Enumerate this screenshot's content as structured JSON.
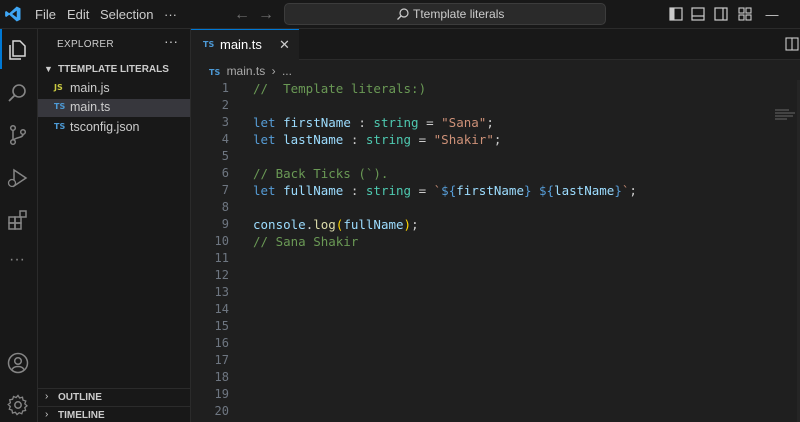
{
  "menu": {
    "file": "File",
    "edit": "Edit",
    "selection": "Selection",
    "more": "···"
  },
  "search": {
    "text": "Ttemplate literals"
  },
  "sidebar": {
    "title": "EXPLORER",
    "more": "···",
    "folder": "TTEMPLATE LITERALS",
    "files": [
      {
        "icon": "JS",
        "name": "main.js",
        "icon_color": "#cbcb41"
      },
      {
        "icon": "TS",
        "name": "main.ts",
        "icon_color": "#4d9ad6"
      },
      {
        "icon": "TS",
        "name": "tsconfig.json",
        "icon_color": "#4d9ad6"
      }
    ],
    "panels": {
      "outline": "OUTLINE",
      "timeline": "TIMELINE"
    }
  },
  "tab": {
    "icon": "TS",
    "label": "main.ts",
    "close": "✕"
  },
  "breadcrumb": {
    "icon": "TS",
    "file": "main.ts",
    "sep": "›",
    "rest": "..."
  },
  "code": {
    "line_numbers": [
      "1",
      "2",
      "3",
      "4",
      "5",
      "6",
      "7",
      "8",
      "9",
      "10",
      "11",
      "12",
      "13",
      "14",
      "15",
      "16",
      "17",
      "18",
      "19",
      "20"
    ],
    "l1": "//  Template literals:)",
    "l3": {
      "kw": "let",
      "var": "firstName",
      "colon": " : ",
      "ty": "string",
      "eq": " = ",
      "str": "\"Sana\"",
      "end": ";"
    },
    "l4": {
      "kw": "let",
      "var": "lastName",
      "colon": " : ",
      "ty": "string",
      "eq": " = ",
      "str": "\"Shakir\"",
      "end": ";"
    },
    "l6": "// Back Ticks (`).",
    "l7": {
      "kw": "let",
      "var": "fullName",
      "colon": " : ",
      "ty": "string",
      "eq": " = ",
      "tick_open": "`",
      "d1": "${",
      "v1": "firstName",
      "c1": "}",
      "sp": " ",
      "d2": "${",
      "v2": "lastName",
      "c2": "}",
      "tick_close": "`",
      "end": ";"
    },
    "l9": {
      "obj": "console",
      "dot": ".",
      "fn": "log",
      "po": "(",
      "arg": "fullName",
      "pc": ")",
      "end": ";"
    },
    "l10": "// Sana Shakir"
  },
  "colors": {
    "accent": "#0078d4",
    "keyword": "#569cd6",
    "string": "#ce9178",
    "comment": "#6a9955",
    "type": "#4ec9b0",
    "variable": "#9cdcfe"
  }
}
